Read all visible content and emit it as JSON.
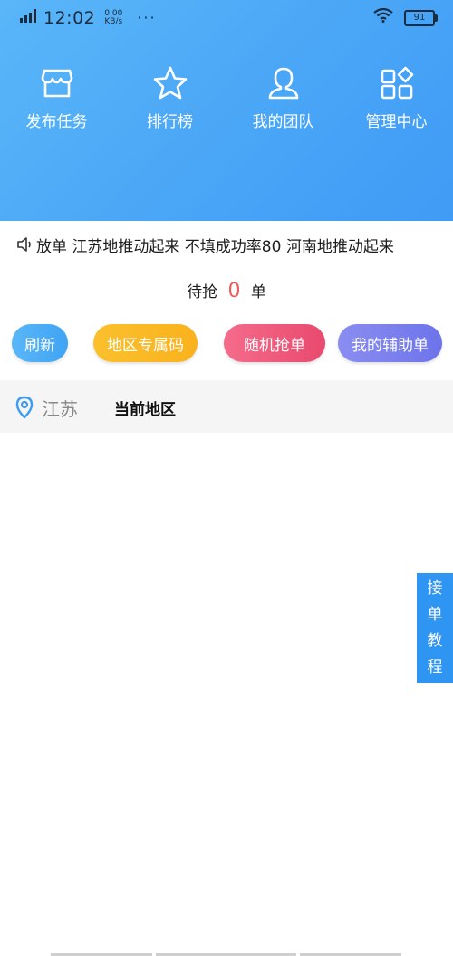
{
  "status_bar": {
    "signal_label": "G",
    "time": "12:02",
    "speed_value": "0.00",
    "speed_unit": "KB/s",
    "more": "···",
    "battery": "91"
  },
  "menu": [
    {
      "label": "发布任务",
      "icon": "store-icon"
    },
    {
      "label": "排行榜",
      "icon": "star-icon"
    },
    {
      "label": "我的团队",
      "icon": "user-icon"
    },
    {
      "label": "管理中心",
      "icon": "apps-icon"
    }
  ],
  "marquee": {
    "text": "放单 江苏地推动起来 不填成功率80 河南地推动起来"
  },
  "pending": {
    "prefix": "待抢",
    "count": "0",
    "suffix": "单"
  },
  "actions": {
    "refresh": "刷新",
    "region_code": "地区专属码",
    "random_grab": "随机抢单",
    "my_helper": "我的辅助单"
  },
  "region": {
    "name": "江苏",
    "caption": "当前地区"
  },
  "side_tab": [
    "接",
    "单",
    "教",
    "程"
  ],
  "colors": {
    "header_gradient_start": "#5ab6f8",
    "header_gradient_end": "#3f9bf5",
    "count_color": "#ef5a5a",
    "refresh_button": "#4aaef6",
    "region_code_button": "#fbb928",
    "random_button": "#ee5a7c",
    "helper_button": "#7b80ee",
    "side_tab": "#2f95f2"
  }
}
